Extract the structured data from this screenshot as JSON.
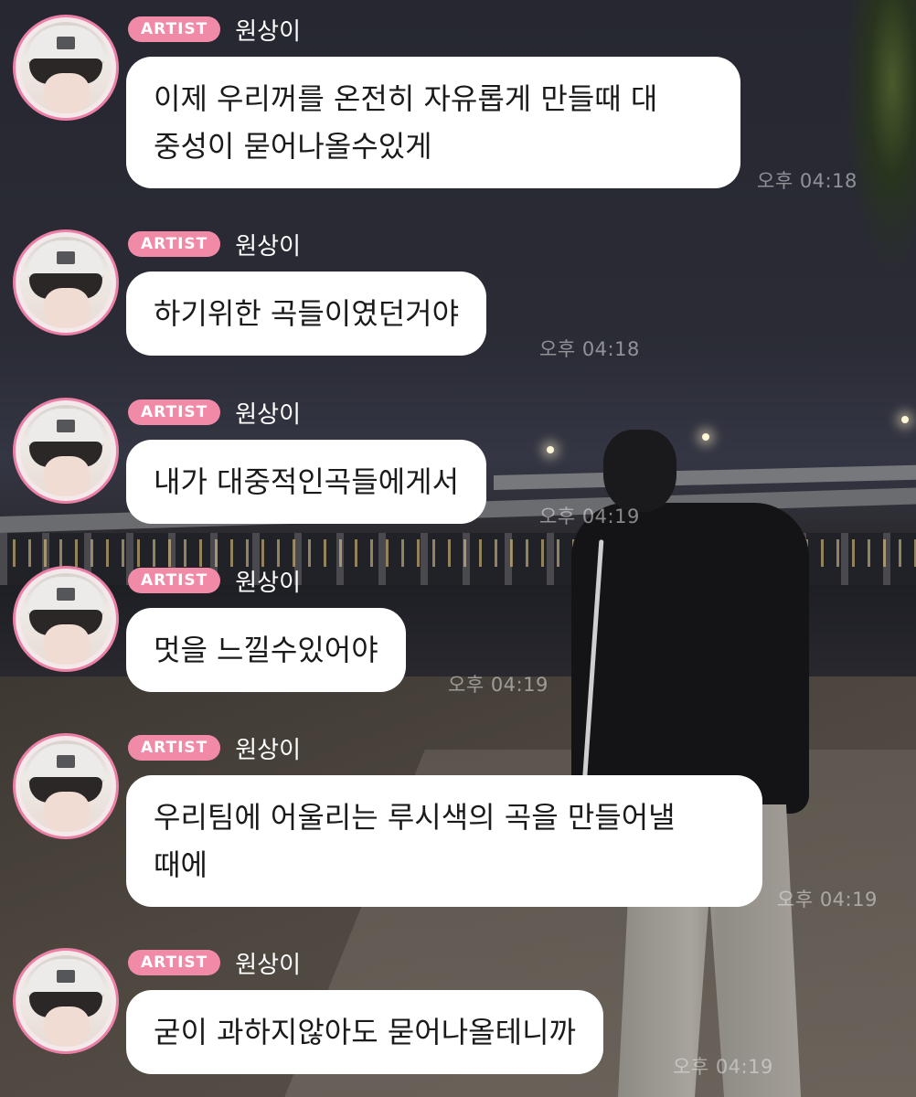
{
  "chat": {
    "badge_label": "ARTIST",
    "messages": [
      {
        "name": "원상이",
        "text": "이제 우리꺼를 온전히 자유롭게 만들때 대\n중성이 묻어나올수있게",
        "time": "오후 04:18"
      },
      {
        "name": "원상이",
        "text": "하기위한 곡들이였던거야",
        "time": "오후 04:18"
      },
      {
        "name": "원상이",
        "text": "내가 대중적인곡들에게서",
        "time": "오후 04:19"
      },
      {
        "name": "원상이",
        "text": "멋을 느낄수있어야",
        "time": "오후 04:19"
      },
      {
        "name": "원상이",
        "text": "우리팀에 어울리는 루시색의 곡을 만들어낼\n때에",
        "time": "오후 04:19"
      },
      {
        "name": "원상이",
        "text": "굳이 과하지않아도 묻어나올테니까",
        "time": "오후 04:19"
      }
    ]
  },
  "colors": {
    "badge": "#f08aa7",
    "avatar_ring": "#ec7fa6",
    "bubble": "#ffffff"
  }
}
